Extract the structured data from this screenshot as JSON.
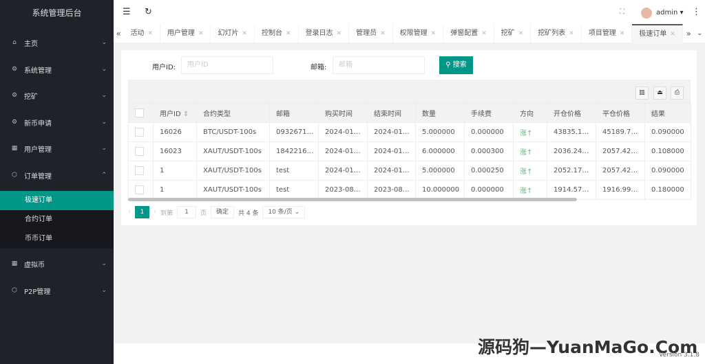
{
  "app_title": "系统管理后台",
  "sidebar": {
    "items": [
      {
        "label": "主页",
        "icon": "home-icon",
        "glyph": "⌂",
        "expanded": false
      },
      {
        "label": "系统管理",
        "icon": "gear-icon",
        "glyph": "⚙",
        "expanded": false
      },
      {
        "label": "挖矿",
        "icon": "gear-icon",
        "glyph": "⚙",
        "expanded": false
      },
      {
        "label": "新币申请",
        "icon": "gear-icon",
        "glyph": "⚙",
        "expanded": false
      },
      {
        "label": "用户管理",
        "icon": "grid-icon",
        "glyph": "▦",
        "expanded": false
      },
      {
        "label": "订单管理",
        "icon": "cube-icon",
        "glyph": "⬡",
        "expanded": true
      },
      {
        "label": "虚拟币",
        "icon": "grid-icon",
        "glyph": "▦",
        "expanded": false
      },
      {
        "label": "P2P管理",
        "icon": "cube-icon",
        "glyph": "⬡",
        "expanded": false
      }
    ],
    "submenu": [
      "极速订单",
      "合约订单",
      "币币订单"
    ],
    "active_sub": "极速订单"
  },
  "header": {
    "user": "admin"
  },
  "tabs": [
    "活动",
    "用户管理",
    "幻灯片",
    "控制台",
    "登录日志",
    "管理员",
    "权限管理",
    "弹窗配置",
    "挖矿",
    "挖矿列表",
    "项目管理",
    "极速订单"
  ],
  "active_tab": "极速订单",
  "search": {
    "uid_label": "用户ID:",
    "uid_placeholder": "用户ID",
    "email_label": "邮箱:",
    "email_placeholder": "邮箱",
    "button": "搜索"
  },
  "table": {
    "columns": [
      "用户ID",
      "合约类型",
      "邮箱",
      "购买时间",
      "结束时间",
      "数量",
      "手续费",
      "方向",
      "开仓价格",
      "平仓价格",
      "结果"
    ],
    "rows": [
      [
        "16026",
        "BTC/USDT-100s",
        "0932671…",
        "2024-01…",
        "2024-01…",
        "5.000000",
        "0.000000",
        "涨↑",
        "43835.1…",
        "45189.7…",
        "0.090000"
      ],
      [
        "16023",
        "XAUT/USDT-100s",
        "1842216…",
        "2024-01…",
        "2024-01…",
        "6.000000",
        "0.000300",
        "涨↑",
        "2036.24…",
        "2057.42…",
        "0.108000"
      ],
      [
        "1",
        "XAUT/USDT-100s",
        "test",
        "2024-01…",
        "2024-01…",
        "5.000000",
        "0.000250",
        "涨↑",
        "2052.17…",
        "2057.42…",
        "0.090000"
      ],
      [
        "1",
        "XAUT/USDT-100s",
        "test",
        "2023-08…",
        "2023-08…",
        "10.000000",
        "0.000000",
        "涨↑",
        "1914.57…",
        "1916.99…",
        "0.180000"
      ]
    ]
  },
  "pagination": {
    "current": "1",
    "goto_label": "到第",
    "goto_value": "1",
    "page_unit": "页",
    "confirm": "确定",
    "total": "共 4 条",
    "page_size": "10 条/页"
  },
  "watermark": "源码狗—YuanMaGo.Com",
  "version": "Version 3.1.8",
  "colors": {
    "accent": "#009688",
    "sidebar": "#20222a",
    "up": "#5fb878"
  }
}
